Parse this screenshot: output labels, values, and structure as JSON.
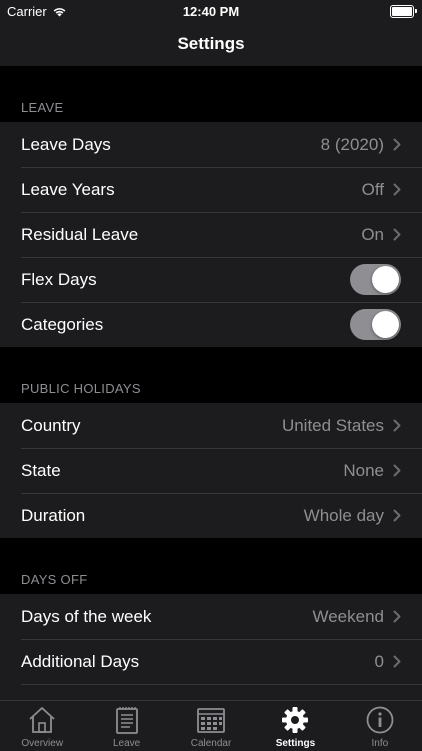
{
  "status": {
    "carrier": "Carrier",
    "time": "12:40 PM"
  },
  "nav": {
    "title": "Settings"
  },
  "sections": [
    {
      "header": "LEAVE",
      "rows": [
        {
          "label": "Leave Days",
          "value": "8 (2020)"
        },
        {
          "label": "Leave Years",
          "value": "Off"
        },
        {
          "label": "Residual Leave",
          "value": "On"
        },
        {
          "label": "Flex Days",
          "toggle": "on"
        },
        {
          "label": "Categories",
          "toggle": "on"
        }
      ]
    },
    {
      "header": "PUBLIC HOLIDAYS",
      "rows": [
        {
          "label": "Country",
          "value": "United States"
        },
        {
          "label": "State",
          "value": "None"
        },
        {
          "label": "Duration",
          "value": "Whole day"
        }
      ]
    },
    {
      "header": "DAYS OFF",
      "rows": [
        {
          "label": "Days of the week",
          "value": "Weekend"
        },
        {
          "label": "Additional Days",
          "value": "0"
        }
      ]
    }
  ],
  "tabs": [
    {
      "label": "Overview",
      "icon": "house-icon"
    },
    {
      "label": "Leave",
      "icon": "notepad-icon"
    },
    {
      "label": "Calendar",
      "icon": "calendar-icon"
    },
    {
      "label": "Settings",
      "icon": "gear-icon",
      "active": true
    },
    {
      "label": "Info",
      "icon": "info-icon"
    }
  ],
  "colors": {
    "background": "#000000",
    "cell": "#1c1c1e",
    "secondary_text": "#8e8e93",
    "toggle_on": "#8e8e93"
  }
}
